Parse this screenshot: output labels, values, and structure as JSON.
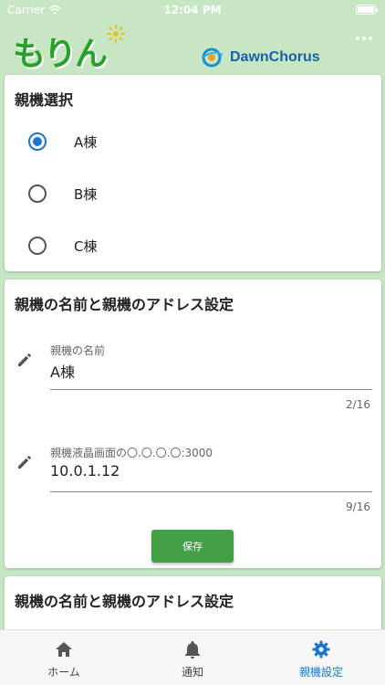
{
  "status_bar": {
    "carrier": "Carrier",
    "time": "12:04 PM"
  },
  "header": {
    "app_logo_text": "もりん",
    "partner_logo_text": "DawnChorus",
    "brand_green": "#2aa02a",
    "partner_blue": "#1a5fa8"
  },
  "parent_select": {
    "title": "親機選択",
    "options": [
      {
        "label": "A棟",
        "selected": true
      },
      {
        "label": "B棟",
        "selected": false
      },
      {
        "label": "C棟",
        "selected": false
      }
    ]
  },
  "name_address_card": {
    "title": "親機の名前と親機のアドレス設定",
    "name_field": {
      "label": "親機の名前",
      "value": "A棟",
      "counter": "2/16"
    },
    "address_field": {
      "label": "親機液晶画面の〇.〇.〇.〇:3000",
      "value": "10.0.1.12",
      "counter": "9/16"
    },
    "save_label": "保存"
  },
  "second_card": {
    "title": "親機の名前と親機のアドレス設定"
  },
  "bottom_nav": {
    "items": [
      {
        "label": "ホーム",
        "icon": "home-icon",
        "active": false
      },
      {
        "label": "通知",
        "icon": "bell-icon",
        "active": false
      },
      {
        "label": "親機設定",
        "icon": "gear-icon",
        "active": true
      }
    ],
    "active_color": "#1976d2"
  }
}
